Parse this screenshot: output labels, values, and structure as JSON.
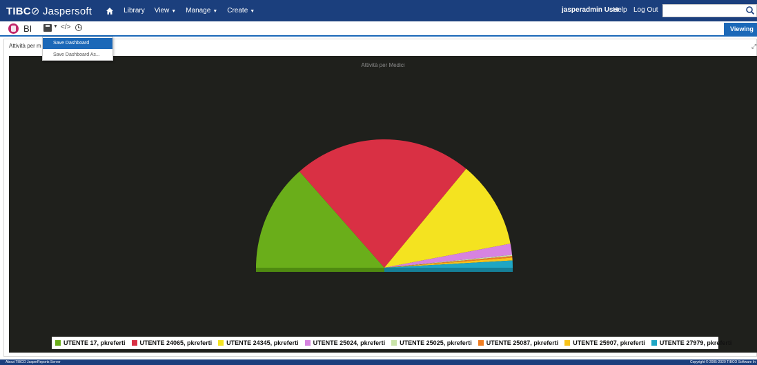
{
  "app": {
    "logo_prefix": "TIBC",
    "logo_suffix": "Jaspersoft",
    "nav": [
      "Library",
      "View",
      "Manage",
      "Create"
    ],
    "user": "jasperadmin User",
    "help": "Help",
    "logout": "Log Out",
    "search_placeholder": ""
  },
  "toolbar": {
    "title": "BI",
    "viewing_label": "Viewing"
  },
  "dropdown": {
    "items": [
      "Save Dashboard",
      "Save Dashboard As..."
    ]
  },
  "panel": {
    "title": "Attività per m"
  },
  "chart_data": {
    "type": "pie",
    "style": "semicircle",
    "title": "Attività per Medici",
    "background": "#1f201c",
    "legend_position": "bottom",
    "series": [
      {
        "name": "UTENTE 17, pkreferti",
        "value": 27.0,
        "color": "#6aae1a"
      },
      {
        "name": "UTENTE 24065, pkreferti",
        "value": 45.0,
        "color": "#d93044"
      },
      {
        "name": "UTENTE 24345, pkreferti",
        "value": 22.0,
        "color": "#f4e320"
      },
      {
        "name": "UTENTE 25024, pkreferti",
        "value": 2.8,
        "color": "#d783e0"
      },
      {
        "name": "UTENTE 25025, pkreferti",
        "value": 0.3,
        "color": "#c9e3a8"
      },
      {
        "name": "UTENTE 25087, pkreferti",
        "value": 0.4,
        "color": "#ef7d22"
      },
      {
        "name": "UTENTE 25907, pkreferti",
        "value": 0.7,
        "color": "#f8c31a"
      },
      {
        "name": "UTENTE 27979, pkreferti",
        "value": 1.8,
        "color": "#1fa6c4"
      }
    ]
  },
  "footer": {
    "left": "About TIBCO JasperReports Server",
    "right": "Copyright © 2005-2020 TIBCO Software In"
  },
  "colors": {
    "brand": "#1b3f7d",
    "accent": "#1b68b8"
  }
}
